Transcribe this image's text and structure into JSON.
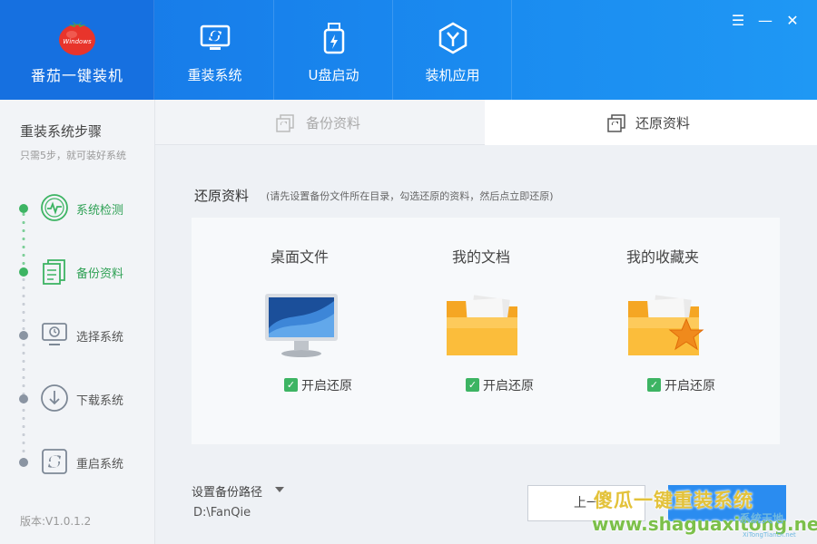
{
  "app": {
    "title": "番茄一键装机",
    "logo_word": "Windows"
  },
  "nav": {
    "tabs": [
      {
        "label": "重装系统"
      },
      {
        "label": "U盘启动"
      },
      {
        "label": "装机应用"
      }
    ]
  },
  "window_controls": {
    "menu": "☰",
    "minimize": "—",
    "close": "✕"
  },
  "sidebar": {
    "title": "重装系统步骤",
    "subtitle": "只需5步，就可装好系统",
    "steps": [
      {
        "label": "系统检测",
        "icon": "system-check-icon",
        "done": true
      },
      {
        "label": "备份资料",
        "icon": "backup-icon",
        "done": true
      },
      {
        "label": "选择系统",
        "icon": "select-system-icon",
        "done": false
      },
      {
        "label": "下载系统",
        "icon": "download-icon",
        "done": false
      },
      {
        "label": "重启系统",
        "icon": "restart-icon",
        "done": false
      }
    ],
    "version": "版本:V1.0.1.2"
  },
  "subtabs": {
    "backup": "备份资料",
    "restore": "还原资料",
    "active": "restore"
  },
  "content": {
    "title": "还原资料",
    "hint": "(请先设置备份文件所在目录，勾选还原的资料，然后点立即还原)",
    "items": [
      {
        "label": "桌面文件",
        "check_label": "开启还原",
        "checked": true,
        "icon": "desktop-monitor-icon"
      },
      {
        "label": "我的文档",
        "check_label": "开启还原",
        "checked": true,
        "icon": "folder-icon"
      },
      {
        "label": "我的收藏夹",
        "check_label": "开启还原",
        "checked": true,
        "icon": "favorites-folder-icon"
      }
    ],
    "path_label": "设置备份路径",
    "path_value": "D:\\FanQie"
  },
  "buttons": {
    "prev": "上一",
    "next": ""
  },
  "watermark": {
    "line1": "傻瓜一键重装系统",
    "line2": "www.shaguaxitong.net",
    "line3": "系统天地",
    "line4": "XiTongTianDi.net"
  },
  "colors": {
    "header_blue": "#1a8bf0",
    "accent_green": "#3db463",
    "sidebar_bg": "#f2f4f7"
  }
}
